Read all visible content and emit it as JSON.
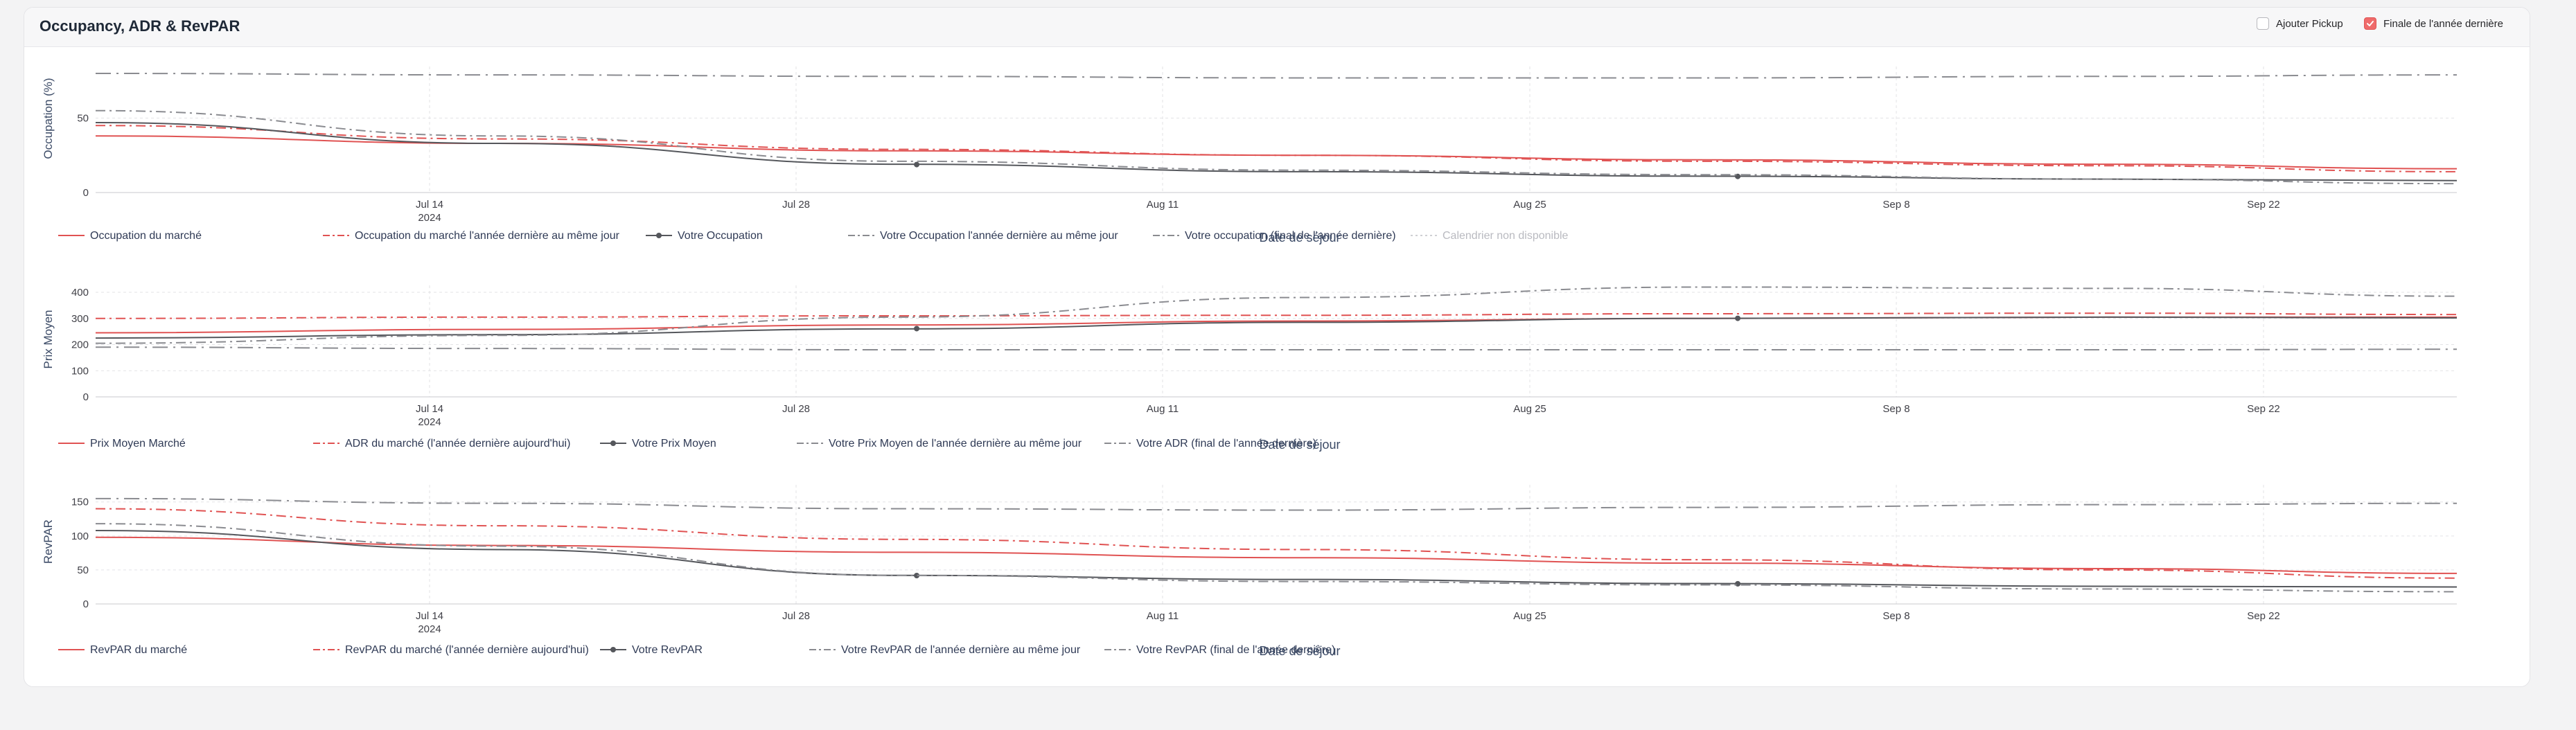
{
  "header": {
    "title": "Occupancy, ADR & RevPAR",
    "options": [
      {
        "label": "Ajouter Pickup",
        "checked": false,
        "icon": "checkbox-empty-icon"
      },
      {
        "label": "Finale de l'année dernière",
        "checked": true,
        "icon": "checkbox-checked-icon"
      }
    ]
  },
  "chart_data": [
    {
      "type": "line",
      "ylabel": "Occupation (%)",
      "xlabel": "Date de séjour",
      "x_ticks": [
        "Jul 14\n2024",
        "Jul 28",
        "Aug 11",
        "Aug 25",
        "Sep 8",
        "Sep 22"
      ],
      "y_ticks": [
        0,
        50
      ],
      "ylim": [
        0,
        80
      ],
      "x_range": [
        "2024-07-04",
        "2024-09-30"
      ],
      "grid": true,
      "legend": "bottom",
      "x": [
        "2024-07-04",
        "2024-07-19",
        "2024-08-03",
        "2024-08-18",
        "2024-09-02",
        "2024-09-17",
        "2024-09-30"
      ],
      "series": [
        {
          "name": "Occupation du marché",
          "color": "#e05252",
          "dash": "solid",
          "marker": false,
          "values": [
            38,
            33,
            28,
            25,
            22,
            19,
            16
          ]
        },
        {
          "name": "Occupation du marché l'année dernière au même jour",
          "color": "#e05252",
          "dash": "dashdot",
          "marker": false,
          "values": [
            45,
            36,
            29,
            25,
            21,
            18,
            14
          ]
        },
        {
          "name": "Votre Occupation",
          "color": "#55575c",
          "dash": "solid",
          "marker": true,
          "marker_points": [
            0.34,
            0.68
          ],
          "values": [
            47,
            33,
            19,
            14,
            11,
            9,
            8
          ]
        },
        {
          "name": "Votre Occupation l'année dernière au même jour",
          "color": "#8a8b90",
          "dash": "dashdot",
          "marker": false,
          "values": [
            55,
            38,
            21,
            15,
            12,
            9,
            6
          ]
        },
        {
          "name": "Votre occupation (final de l'année dernière)",
          "color": "#8a8b90",
          "dash": "longdashdot",
          "marker": false,
          "values": [
            80,
            79,
            78,
            77,
            77,
            78,
            79
          ]
        },
        {
          "name": "Calendrier non disponible",
          "color": "#cfd0d4",
          "dash": "dotted",
          "marker": false,
          "values": []
        }
      ]
    },
    {
      "type": "line",
      "ylabel": "Prix Moyen",
      "xlabel": "Date de séjour",
      "x_ticks": [
        "Jul 14\n2024",
        "Jul 28",
        "Aug 11",
        "Aug 25",
        "Sep 8",
        "Sep 22"
      ],
      "y_ticks": [
        0,
        100,
        200,
        300,
        400
      ],
      "ylim": [
        0,
        400
      ],
      "x_range": [
        "2024-07-04",
        "2024-09-30"
      ],
      "grid": true,
      "legend": "bottom",
      "x": [
        "2024-07-04",
        "2024-07-19",
        "2024-08-03",
        "2024-08-18",
        "2024-09-02",
        "2024-09-17",
        "2024-09-30"
      ],
      "series": [
        {
          "name": "Prix Moyen Marché",
          "color": "#e05252",
          "dash": "solid",
          "marker": false,
          "values": [
            245,
            258,
            275,
            290,
            300,
            305,
            305
          ]
        },
        {
          "name": "ADR du marché (l'année dernière aujourd'hui)",
          "color": "#e05252",
          "dash": "dashdot",
          "marker": false,
          "values": [
            300,
            305,
            310,
            312,
            318,
            320,
            315
          ]
        },
        {
          "name": "Votre Prix Moyen",
          "color": "#55575c",
          "dash": "solid",
          "marker": true,
          "marker_points": [
            0.34,
            0.68
          ],
          "values": [
            225,
            238,
            260,
            285,
            300,
            305,
            302
          ]
        },
        {
          "name": "Votre Prix Moyen de l'année dernière au même jour",
          "color": "#8a8b90",
          "dash": "dashdot",
          "marker": false,
          "values": [
            205,
            235,
            305,
            380,
            420,
            415,
            385
          ]
        },
        {
          "name": "Votre ADR (final de l'année dernière)",
          "color": "#8a8b90",
          "dash": "longdashdot",
          "marker": false,
          "values": [
            190,
            185,
            180,
            180,
            180,
            180,
            182
          ]
        }
      ]
    },
    {
      "type": "line",
      "ylabel": "RevPAR",
      "xlabel": "Date de séjour",
      "x_ticks": [
        "Jul 14\n2024",
        "Jul 28",
        "Aug 11",
        "Aug 25",
        "Sep 8",
        "Sep 22"
      ],
      "y_ticks": [
        0,
        50,
        100,
        150
      ],
      "ylim": [
        0,
        165
      ],
      "x_range": [
        "2024-07-04",
        "2024-09-30"
      ],
      "grid": true,
      "legend": "bottom",
      "x": [
        "2024-07-04",
        "2024-07-19",
        "2024-08-03",
        "2024-08-18",
        "2024-09-02",
        "2024-09-17",
        "2024-09-30"
      ],
      "series": [
        {
          "name": "RevPAR du marché",
          "color": "#e05252",
          "dash": "solid",
          "marker": false,
          "values": [
            98,
            86,
            76,
            68,
            60,
            52,
            45
          ]
        },
        {
          "name": "RevPAR du marché (l'année dernière aujourd'hui)",
          "color": "#e05252",
          "dash": "dashdot",
          "marker": false,
          "values": [
            140,
            115,
            95,
            80,
            65,
            50,
            38
          ]
        },
        {
          "name": "Votre RevPAR",
          "color": "#55575c",
          "dash": "solid",
          "marker": true,
          "marker_points": [
            0.34,
            0.68
          ],
          "values": [
            108,
            80,
            42,
            36,
            30,
            26,
            25
          ]
        },
        {
          "name": "Votre RevPAR de l'année dernière au même jour",
          "color": "#8a8b90",
          "dash": "dashdot",
          "marker": false,
          "values": [
            118,
            85,
            42,
            33,
            28,
            22,
            18
          ]
        },
        {
          "name": "Votre RevPAR (final de l'année dernière)",
          "color": "#8a8b90",
          "dash": "longdashdot",
          "marker": false,
          "values": [
            155,
            148,
            140,
            138,
            142,
            146,
            148
          ]
        }
      ]
    }
  ]
}
